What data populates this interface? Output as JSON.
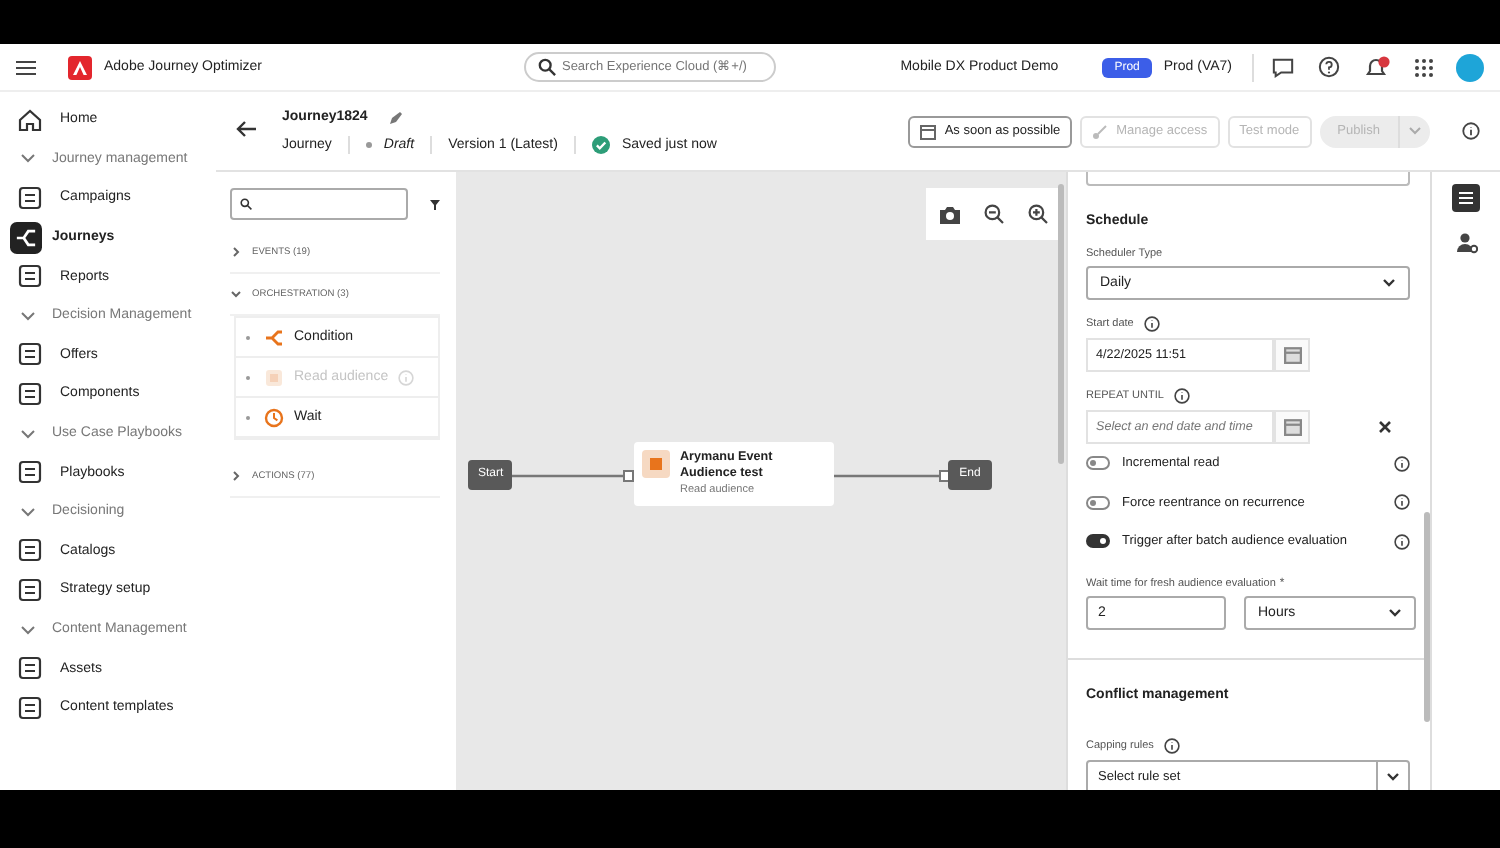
{
  "header": {
    "app_name": "Adobe Journey Optimizer",
    "search": {
      "placeholder": "Search Experience Cloud (⌘+/)"
    },
    "org": "Mobile DX Product Demo",
    "env_badge": "Prod",
    "sandbox": "Prod (VA7)"
  },
  "sidebar": {
    "items": [
      {
        "kind": "link",
        "label": "Home",
        "selected": false
      },
      {
        "kind": "section",
        "label": "Journey management",
        "expanded": true
      },
      {
        "kind": "link",
        "label": "Campaigns",
        "selected": false
      },
      {
        "kind": "link",
        "label": "Journeys",
        "selected": true
      },
      {
        "kind": "link",
        "label": "Reports",
        "selected": false
      },
      {
        "kind": "section",
        "label": "Decision Management",
        "expanded": true
      },
      {
        "kind": "link",
        "label": "Offers",
        "selected": false
      },
      {
        "kind": "link",
        "label": "Components",
        "selected": false
      },
      {
        "kind": "section",
        "label": "Use Case Playbooks",
        "expanded": true
      },
      {
        "kind": "link",
        "label": "Playbooks",
        "selected": false
      },
      {
        "kind": "section",
        "label": "Decisioning",
        "expanded": true
      },
      {
        "kind": "link",
        "label": "Catalogs",
        "selected": false
      },
      {
        "kind": "link",
        "label": "Strategy setup",
        "selected": false
      },
      {
        "kind": "section",
        "label": "Content Management",
        "expanded": true
      },
      {
        "kind": "link",
        "label": "Assets",
        "selected": false
      },
      {
        "kind": "link",
        "label": "Content templates",
        "selected": false
      }
    ]
  },
  "journey": {
    "title": "Journey1824",
    "type": "Journey",
    "status": "Draft",
    "version": "Version 1 (Latest)",
    "save_state": "Saved just now",
    "buttons": [
      {
        "label": "As soon as possible",
        "disabled": false
      },
      {
        "label": "Manage access",
        "disabled": true
      },
      {
        "label": "Test mode",
        "disabled": true
      },
      {
        "label": "Publish",
        "disabled": true
      }
    ]
  },
  "palette": {
    "categories": [
      {
        "label": "EVENTS (19)",
        "expanded": false
      },
      {
        "label": "ORCHESTRATION (3)",
        "expanded": true,
        "items": [
          {
            "label": "Condition",
            "disabled": false
          },
          {
            "label": "Read audience",
            "disabled": true
          },
          {
            "label": "Wait",
            "disabled": false
          }
        ]
      },
      {
        "label": "ACTIONS (77)",
        "expanded": false
      }
    ]
  },
  "canvas": {
    "nodes": [
      {
        "kind": "terminal",
        "label": "Start"
      },
      {
        "kind": "activity",
        "title": "Arymanu Event Audience test",
        "subtitle": "Read audience"
      },
      {
        "kind": "terminal",
        "label": "End"
      }
    ]
  },
  "properties": {
    "schedule": {
      "heading": "Schedule",
      "scheduler_type": {
        "label": "Scheduler Type",
        "value": "Daily"
      },
      "start_date": {
        "label": "Start date",
        "value": "4/22/2025 11:51"
      },
      "repeat_until": {
        "label": "REPEAT UNTIL",
        "placeholder": "Select an end date and time"
      },
      "toggles": [
        {
          "label": "Incremental read",
          "on": false
        },
        {
          "label": "Force reentrance on recurrence",
          "on": false
        },
        {
          "label": "Trigger after batch audience evaluation",
          "on": true
        }
      ],
      "wait_time": {
        "label": "Wait time for fresh audience evaluation",
        "required_mark": "*",
        "value": "2",
        "unit": "Hours"
      }
    },
    "conflict": {
      "heading": "Conflict management",
      "capping_rules": {
        "label": "Capping rules",
        "value": "Select rule set"
      }
    }
  }
}
